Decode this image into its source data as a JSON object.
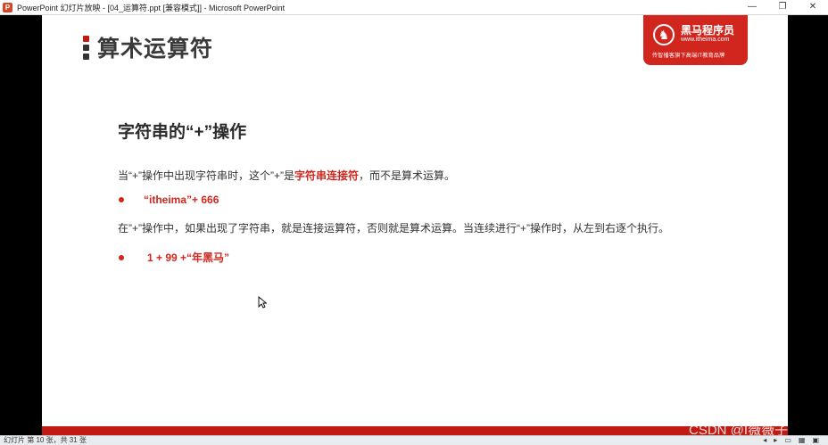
{
  "window": {
    "title": "PowerPoint 幻灯片放映 - [04_运算符.ppt [兼容模式]] - Microsoft PowerPoint",
    "app_icon": "powerpoint-icon",
    "controls": {
      "minimize": "—",
      "restore": "❐",
      "close": "✕"
    }
  },
  "slide": {
    "title": "算术运算符",
    "logo": {
      "name": "黑马程序员",
      "url": "www.itheima.com",
      "slogan": "传智播客旗下高端IT教育品牌",
      "brand_color": "#d0261e"
    },
    "heading": "字符串的“+”操作",
    "paragraph1": {
      "before": "当“+”操作中出现字符串时，这个”+”是",
      "highlight": "字符串连接符",
      "after": "，而不是算术运算。"
    },
    "bullet1": "“itheima”+ 666",
    "paragraph2": "在”+”操作中，如果出现了字符串，就是连接运算符，否则就是算术运算。当连续进行“+”操作时，从左到右逐个执行。",
    "bullet2": "1 + 99 +“年黑马”",
    "accent_color": "#c11a13"
  },
  "status": {
    "slide_info": "幻灯片 第 10 张，共 31 张",
    "icons": [
      "prev-icon",
      "next-icon",
      "normal-view-icon",
      "sorter-view-icon",
      "slideshow-icon"
    ]
  },
  "watermark": "CSDN @I薇薇子"
}
